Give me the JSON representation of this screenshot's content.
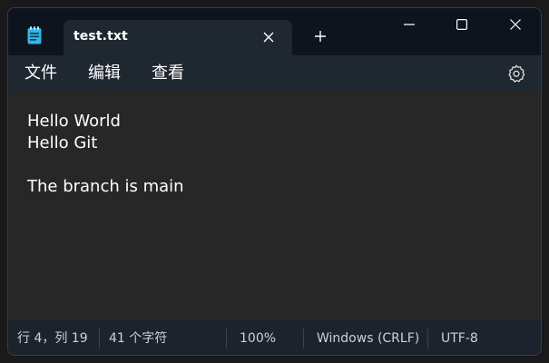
{
  "window": {
    "tab_title": "test.txt",
    "icons": {
      "app": "notepad-icon",
      "tab_close": "close-icon",
      "new_tab": "plus-icon",
      "minimize": "minimize-icon",
      "maximize": "maximize-icon",
      "close": "close-icon",
      "settings": "gear-icon"
    }
  },
  "menu": {
    "file": "文件",
    "edit": "编辑",
    "view": "查看"
  },
  "editor": {
    "content": "Hello World\nHello Git\n\nThe branch is main"
  },
  "status": {
    "position": "行 4，列 19",
    "char_count": "41 个字符",
    "zoom": "100%",
    "line_ending": "Windows (CRLF)",
    "encoding": "UTF-8"
  },
  "colors": {
    "titlebar": "#0e141d",
    "tab_active": "#1f2731",
    "menubar": "#1f2731",
    "editor_bg": "#272727",
    "statusbar": "#1c232d",
    "app_icon": "#35b4e8"
  }
}
